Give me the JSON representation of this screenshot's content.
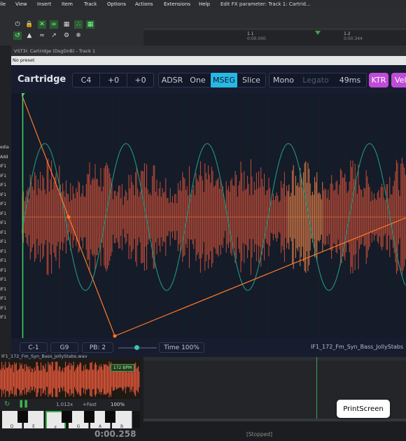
{
  "menubar": {
    "items": [
      "View",
      "Insert",
      "Item",
      "Track",
      "Options",
      "Actions",
      "Extensions",
      "Help"
    ],
    "edit_title": "Edit FX parameter: Track 1: Cartrid..."
  },
  "timeline": {
    "marks": [
      {
        "label": "1.1",
        "time": "0:00.000"
      },
      {
        "label": "1.2",
        "time": "0:00.344"
      }
    ]
  },
  "left_strip": {
    "labels": [
      "edia",
      "Add",
      "IF1",
      "IF1",
      "IF1",
      "IF1",
      "IF1",
      "IF1",
      "IF1",
      "IF1",
      "IF1",
      "IF1",
      "IF1",
      "IF1",
      "IF1",
      "IF1",
      "IF1",
      "IF1",
      "IF1"
    ]
  },
  "plugin_window": {
    "title": "VST3i: Cartridge (DsgDnB) - Track 1",
    "preset": "No preset"
  },
  "plugin": {
    "name": "Cartridge",
    "note": "C4",
    "semitone": "+0",
    "fine": "+0",
    "modes": [
      "ADSR",
      "One",
      "MSEG",
      "Slice"
    ],
    "active_mode": "MSEG",
    "mono": "Mono",
    "legato": "Legato",
    "glide": "49ms",
    "ktr": "KTR",
    "vel": "Vel",
    "footer": {
      "low_key": "C-1",
      "high_key": "G9",
      "pitch_bend": "PB: 2",
      "time_stretch": "Time 100%",
      "sample_name": "IF1_172_Fm_Syn_Bass_JollyStabs"
    }
  },
  "mini_editor": {
    "file_name": "IF1_172_Fm_Syn_Bass_JollyStabs.wav",
    "bpm_badge": "172 BPM",
    "zoom": "1.012x",
    "mode": "+Fast",
    "volume": "100%",
    "keys": [
      "D",
      "E",
      "F",
      "G",
      "A",
      "B"
    ],
    "selected_key": "F"
  },
  "transport": {
    "time": "0:00.258",
    "status": "[Stopped]"
  },
  "overlay": {
    "printscreen": "PrintScreen"
  },
  "colors": {
    "accent_cyan": "#27b8e6",
    "accent_purple": "#c04bd8",
    "waveform": "#e2573a",
    "envelope": "#ff7a2a",
    "lfo": "#1f8f7a",
    "green_ui": "#3fa058"
  }
}
